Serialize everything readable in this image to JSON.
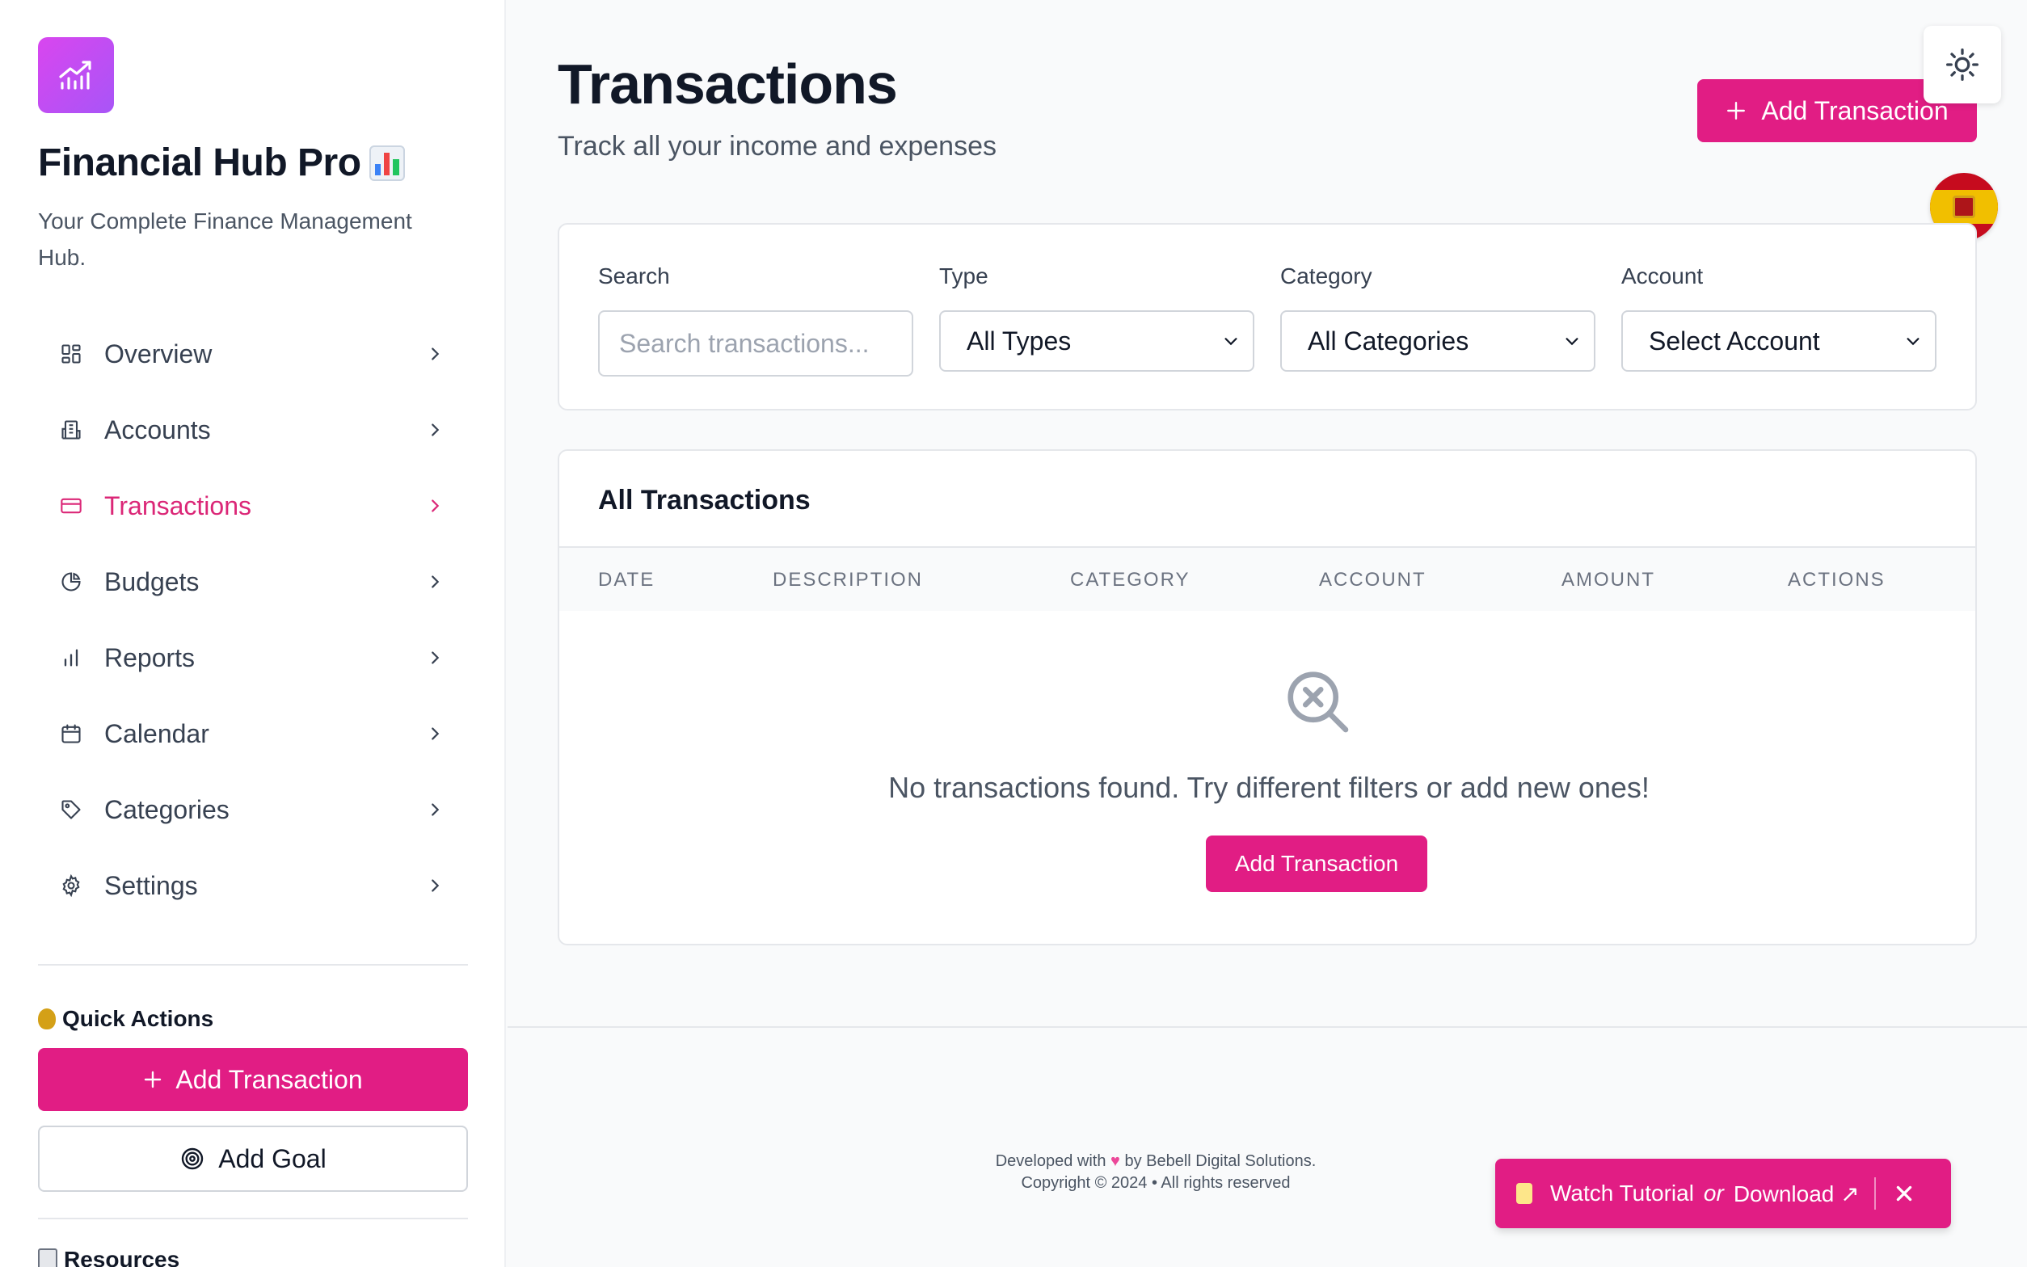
{
  "sidebar": {
    "app_title": "Financial Hub Pro",
    "app_subtitle": "Your Complete Finance Management Hub.",
    "items": [
      {
        "label": "Overview",
        "icon": "grid-icon"
      },
      {
        "label": "Accounts",
        "icon": "building-icon"
      },
      {
        "label": "Transactions",
        "icon": "credit-card-icon",
        "active": true
      },
      {
        "label": "Budgets",
        "icon": "pie-chart-icon"
      },
      {
        "label": "Reports",
        "icon": "bar-chart-icon"
      },
      {
        "label": "Calendar",
        "icon": "calendar-icon"
      },
      {
        "label": "Categories",
        "icon": "tag-icon"
      },
      {
        "label": "Settings",
        "icon": "gear-icon"
      }
    ],
    "quick_actions_title": "Quick Actions",
    "add_transaction": "Add Transaction",
    "add_goal": "Add Goal",
    "resources_title": "Resources"
  },
  "header": {
    "title": "Transactions",
    "subtitle": "Track all your income and expenses",
    "add_button": "Add Transaction"
  },
  "filters": {
    "search_label": "Search",
    "search_placeholder": "Search transactions...",
    "type_label": "Type",
    "type_value": "All Types",
    "category_label": "Category",
    "category_value": "All Categories",
    "account_label": "Account",
    "account_value": "Select Account"
  },
  "table": {
    "title": "All Transactions",
    "columns": [
      "DATE",
      "DESCRIPTION",
      "CATEGORY",
      "ACCOUNT",
      "AMOUNT",
      "ACTIONS"
    ],
    "empty_text": "No transactions found. Try different filters or add new ones!",
    "empty_button": "Add Transaction"
  },
  "footer": {
    "line1_prefix": "Developed with",
    "line1_suffix": "by Bebell Digital Solutions.",
    "line2": "Copyright © 2024 • All rights reserved"
  },
  "tutorial": {
    "watch": "Watch Tutorial",
    "or": "or",
    "download": "Download ↗"
  },
  "colors": {
    "accent": "#e11d84",
    "active_nav": "#db2777",
    "logo_gradient_start": "#d946ef",
    "logo_gradient_end": "#a855f7"
  }
}
